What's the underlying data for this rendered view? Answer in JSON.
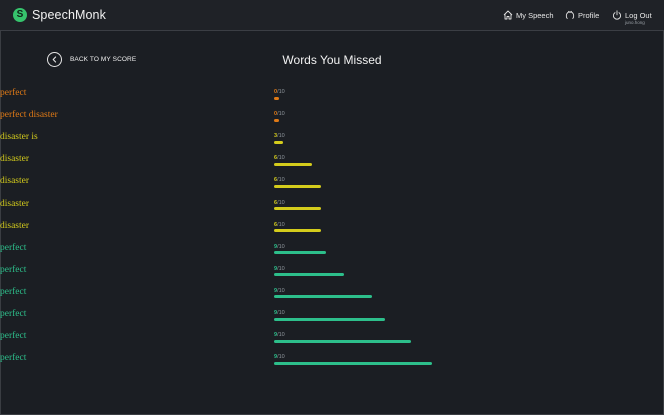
{
  "app": {
    "name": "SpeechMonk",
    "logo_letter": "S",
    "accent": "#36c46d"
  },
  "nav": {
    "my_speech": "My Speech",
    "profile": "Profile",
    "logout": "Log Out",
    "logout_user": "juno.hong"
  },
  "back_button": {
    "label": "BACK TO MY SCORE"
  },
  "page_title": "Words You Missed",
  "score_max": "/10",
  "colors": {
    "low": "#e07a16",
    "mid": "#d4cc1c",
    "high": "#2dbf8b"
  },
  "words": [
    {
      "text": "perfect",
      "score": "0",
      "fraction": 0.03,
      "level": "low"
    },
    {
      "text": "perfect disaster",
      "score": "0",
      "fraction": 0.03,
      "level": "low"
    },
    {
      "text": "disaster is",
      "score": "3",
      "fraction": 0.06,
      "level": "mid"
    },
    {
      "text": "disaster",
      "score": "6",
      "fraction": 0.24,
      "level": "mid"
    },
    {
      "text": "disaster",
      "score": "6",
      "fraction": 0.3,
      "level": "mid"
    },
    {
      "text": "disaster",
      "score": "6",
      "fraction": 0.3,
      "level": "mid"
    },
    {
      "text": "disaster",
      "score": "6",
      "fraction": 0.3,
      "level": "mid"
    },
    {
      "text": "perfect",
      "score": "9",
      "fraction": 0.33,
      "level": "high"
    },
    {
      "text": "perfect",
      "score": "9",
      "fraction": 0.44,
      "level": "high"
    },
    {
      "text": "perfect",
      "score": "9",
      "fraction": 0.62,
      "level": "high"
    },
    {
      "text": "perfect",
      "score": "9",
      "fraction": 0.7,
      "level": "high"
    },
    {
      "text": "perfect",
      "score": "9",
      "fraction": 0.87,
      "level": "high"
    },
    {
      "text": "perfect",
      "score": "9",
      "fraction": 1.0,
      "level": "high"
    }
  ]
}
